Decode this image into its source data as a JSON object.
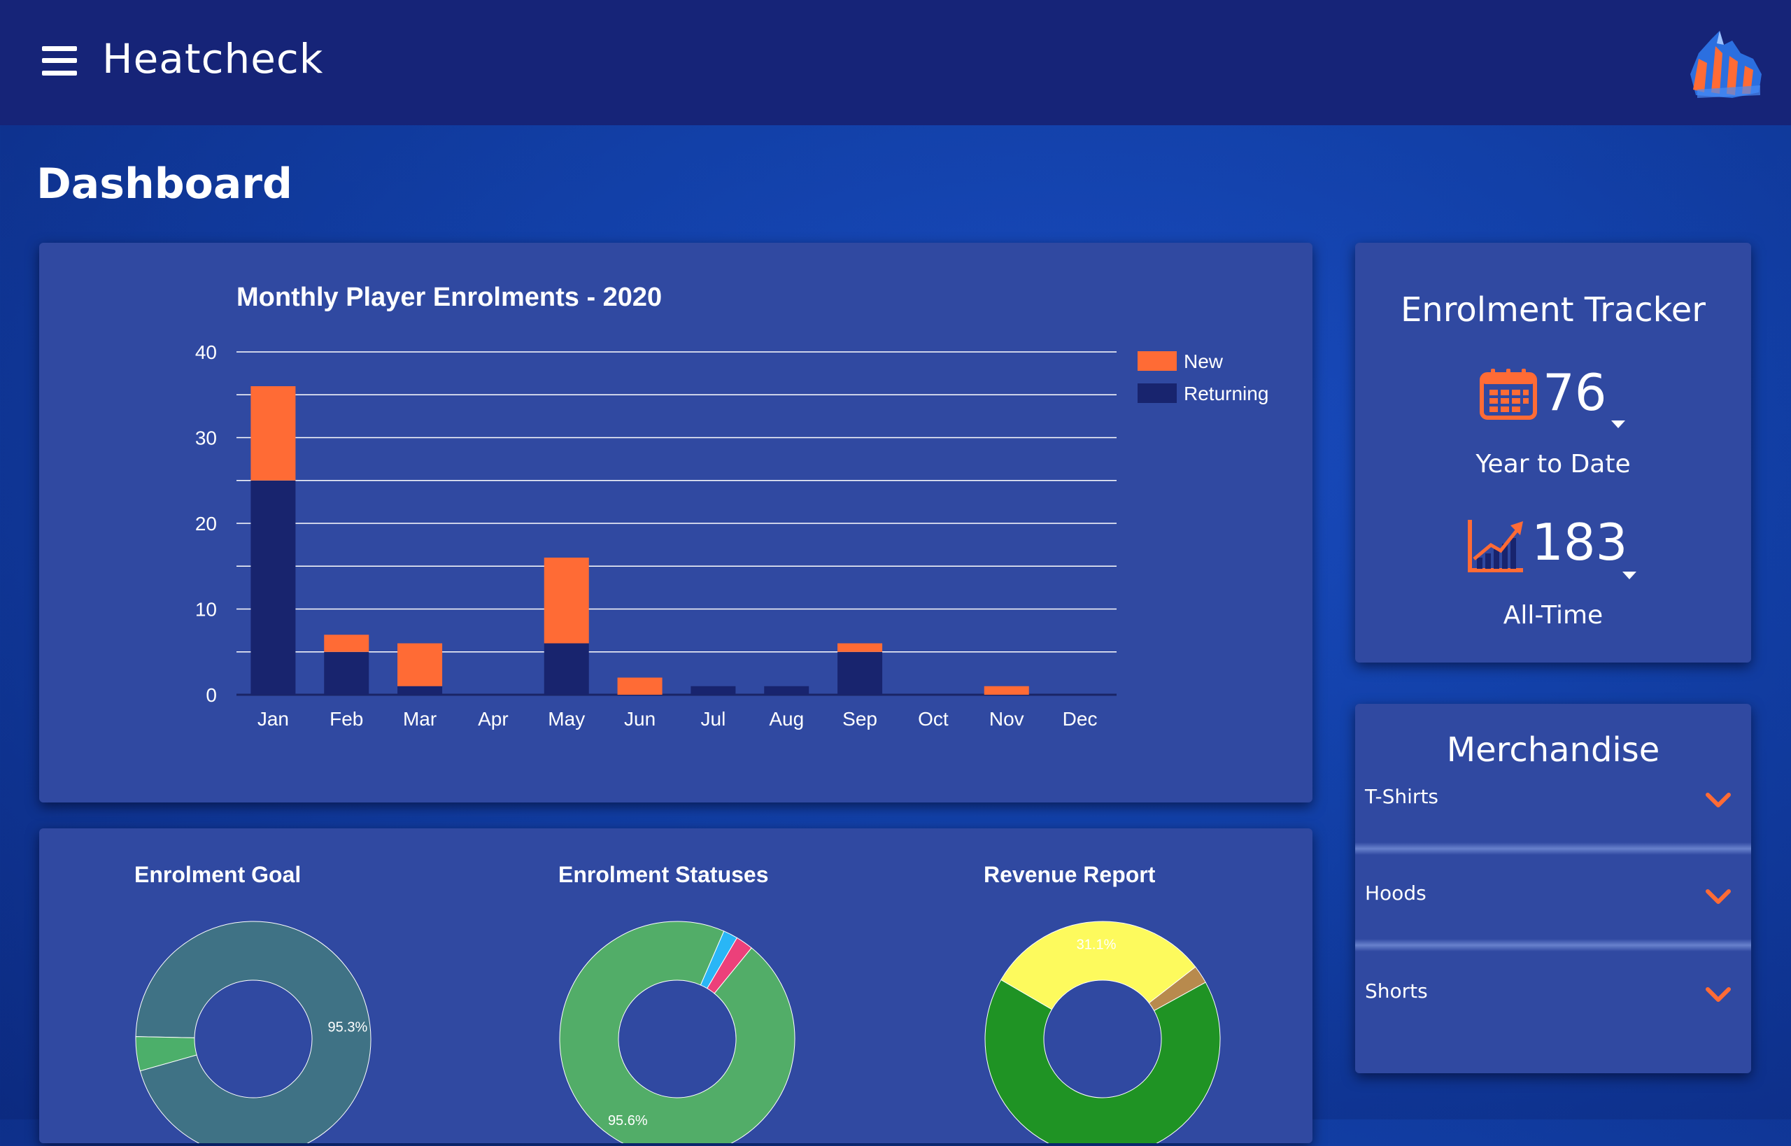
{
  "header": {
    "app_title": "Heatcheck",
    "menu_icon": "hamburger-menu-icon",
    "logo_icon": "team-logo-icon"
  },
  "page": {
    "title": "Dashboard"
  },
  "colors": {
    "new": "#ff6b35",
    "returning": "#18246e",
    "header_bg": "#162478",
    "card_bg": "#3049a1",
    "accent": "#ff6b35"
  },
  "chart_data": [
    {
      "type": "bar",
      "stacked": true,
      "title": "Monthly Player Enrolments - 2020",
      "categories": [
        "Jan",
        "Feb",
        "Mar",
        "Apr",
        "May",
        "Jun",
        "Jul",
        "Aug",
        "Sep",
        "Oct",
        "Nov",
        "Dec"
      ],
      "series": [
        {
          "name": "Returning",
          "color": "#18246e",
          "values": [
            25,
            5,
            1,
            0,
            6,
            0,
            1,
            1,
            5,
            0,
            0,
            0
          ]
        },
        {
          "name": "New",
          "color": "#ff6b35",
          "values": [
            11,
            2,
            5,
            0,
            10,
            2,
            0,
            0,
            1,
            0,
            1,
            0
          ]
        }
      ],
      "yticks": [
        0,
        10,
        20,
        30,
        40
      ],
      "ylim": [
        0,
        40
      ],
      "legend": "right",
      "grid": true
    },
    {
      "type": "pie",
      "donut": true,
      "title": "Enrolment Goal",
      "slices": [
        {
          "value": 95.3,
          "color": "#3f7285",
          "label": "95.3%"
        },
        {
          "value": 4.7,
          "color": "#4caf6a",
          "label": ""
        }
      ]
    },
    {
      "type": "pie",
      "donut": true,
      "title": "Enrolment Statuses",
      "slices": [
        {
          "value": 2.0,
          "color": "#29b6f6",
          "label": ""
        },
        {
          "value": 2.4,
          "color": "#ec407a",
          "label": ""
        },
        {
          "value": 95.6,
          "color": "#52ad68",
          "label": "95.6%"
        }
      ]
    },
    {
      "type": "pie",
      "donut": true,
      "title": "Revenue Report",
      "slices": [
        {
          "value": 2.5,
          "color": "#b88a4d",
          "label": ""
        },
        {
          "value": 66.4,
          "color": "#1f9324",
          "label": ""
        },
        {
          "value": 31.1,
          "color": "#fdfa5d",
          "label": "31.1%"
        }
      ]
    }
  ],
  "tracker": {
    "title": "Enrolment Tracker",
    "ytd_value": "76",
    "ytd_label": "Year to Date",
    "ytd_icon": "calendar-icon",
    "alltime_value": "183",
    "alltime_label": "All-Time",
    "alltime_icon": "growth-chart-icon"
  },
  "merch": {
    "title": "Merchandise",
    "items": [
      {
        "label": "T-Shirts"
      },
      {
        "label": "Hoods"
      },
      {
        "label": "Shorts"
      }
    ]
  }
}
